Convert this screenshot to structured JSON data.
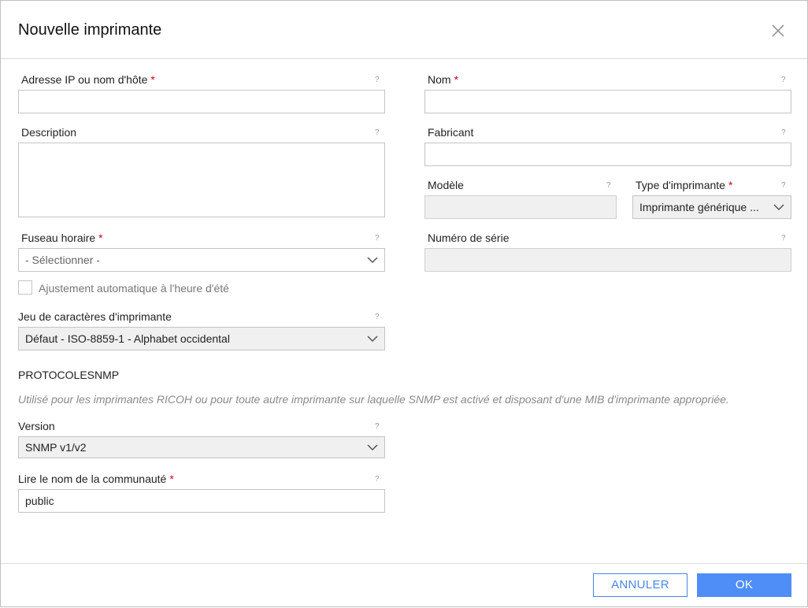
{
  "dialog": {
    "title": "Nouvelle imprimante"
  },
  "help_glyph": "?",
  "required_mark": "*",
  "fields": {
    "address": {
      "label": "Adresse IP ou nom d'hôte",
      "value": ""
    },
    "name": {
      "label": "Nom",
      "value": ""
    },
    "description": {
      "label": "Description",
      "value": ""
    },
    "manufacturer": {
      "label": "Fabricant",
      "value": ""
    },
    "model": {
      "label": "Modèle",
      "value": ""
    },
    "printer_type": {
      "label": "Type d'imprimante",
      "value": "Imprimante générique ..."
    },
    "timezone": {
      "label": "Fuseau horaire",
      "value": "- Sélectionner -"
    },
    "serial": {
      "label": "Numéro de série",
      "value": ""
    },
    "dst": {
      "label": "Ajustement automatique à l'heure d'été",
      "checked": false
    },
    "charset": {
      "label": "Jeu de caractères d'imprimante",
      "value": "Défaut - ISO-8859-1 - Alphabet occidental"
    }
  },
  "snmp": {
    "title": "PROTOCOLESNMP",
    "description": "Utilisé pour les imprimantes RICOH ou pour toute autre imprimante sur laquelle SNMP est activé et disposant d'une MIB d'imprimante appropriée.",
    "version": {
      "label": "Version",
      "value": "SNMP v1/v2"
    },
    "community": {
      "label": "Lire le nom de la communauté",
      "value": "public"
    }
  },
  "buttons": {
    "cancel": "ANNULER",
    "ok": "OK"
  },
  "colors": {
    "accent": "#4f8ef7",
    "required": "#d0021b"
  }
}
